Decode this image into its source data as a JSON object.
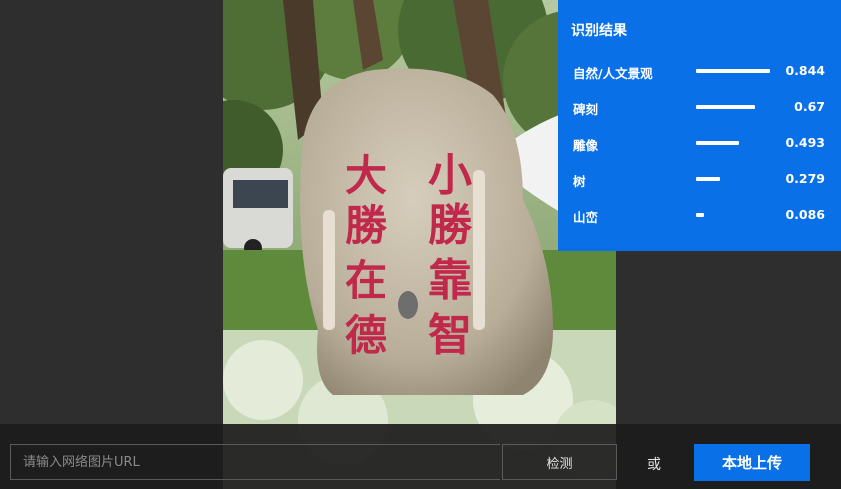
{
  "results": {
    "title": "识别结果",
    "items": [
      {
        "label": "自然/人文景观",
        "score": "0.844",
        "value": 0.844
      },
      {
        "label": "碑刻",
        "score": "0.67",
        "value": 0.67
      },
      {
        "label": "雕像",
        "score": "0.493",
        "value": 0.493
      },
      {
        "label": "树",
        "score": "0.279",
        "value": 0.279
      },
      {
        "label": "山峦",
        "score": "0.086",
        "value": 0.086
      }
    ]
  },
  "stone": {
    "col_right": "小勝靠智",
    "col_left": "大勝在德"
  },
  "bottom_bar": {
    "url_placeholder": "请输入网络图片URL",
    "detect_label": "检测",
    "or_text": "或",
    "upload_label": "本地上传"
  },
  "colors": {
    "accent": "#0a70e8",
    "background": "#2e2e2e",
    "carving": "#c0284c"
  }
}
